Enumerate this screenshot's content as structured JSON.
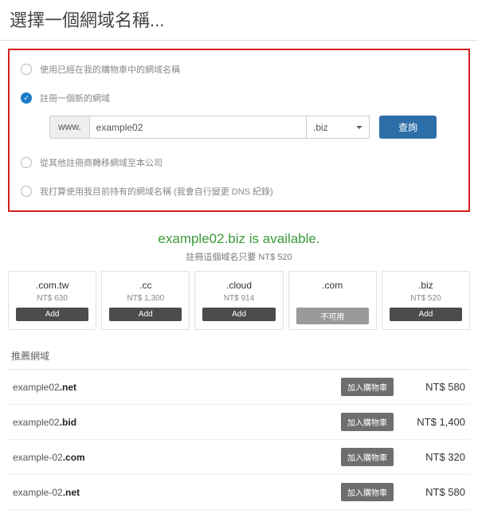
{
  "title": "選擇一個網域名稱...",
  "options": {
    "use_existing": "使用已經在我的購物車中的網域名稱",
    "register_new": "註冊一個新的網域",
    "transfer": "從其他註冊商轉移網域至本公司",
    "use_own": "我打算使用我目前持有的網域名稱 (我會自行變更 DNS 紀錄)"
  },
  "search": {
    "prefix": "www.",
    "value": "example02",
    "tld": ".biz",
    "button": "查詢"
  },
  "availability": {
    "domain": "example02.biz",
    "status": "is available.",
    "sub": "註冊這個域名只要 NT$ 520"
  },
  "suggestions": [
    {
      "tld": ".com.tw",
      "price": "NT$ 630",
      "label": "Add",
      "available": true
    },
    {
      "tld": ".cc",
      "price": "NT$ 1,300",
      "label": "Add",
      "available": true
    },
    {
      "tld": ".cloud",
      "price": "NT$ 914",
      "label": "Add",
      "available": true
    },
    {
      "tld": ".com",
      "price": "",
      "label": "不可用",
      "available": false
    },
    {
      "tld": ".biz",
      "price": "NT$ 520",
      "label": "Add",
      "available": true
    }
  ],
  "recommend": {
    "title": "推薦網域",
    "add_label": "加入購物車",
    "items": [
      {
        "base": "example02",
        "tld": ".net",
        "price": "NT$ 580"
      },
      {
        "base": "example02",
        "tld": ".bid",
        "price": "NT$ 1,400"
      },
      {
        "base": "example-02",
        "tld": ".com",
        "price": "NT$ 320"
      },
      {
        "base": "example-02",
        "tld": ".net",
        "price": "NT$ 580"
      }
    ]
  }
}
